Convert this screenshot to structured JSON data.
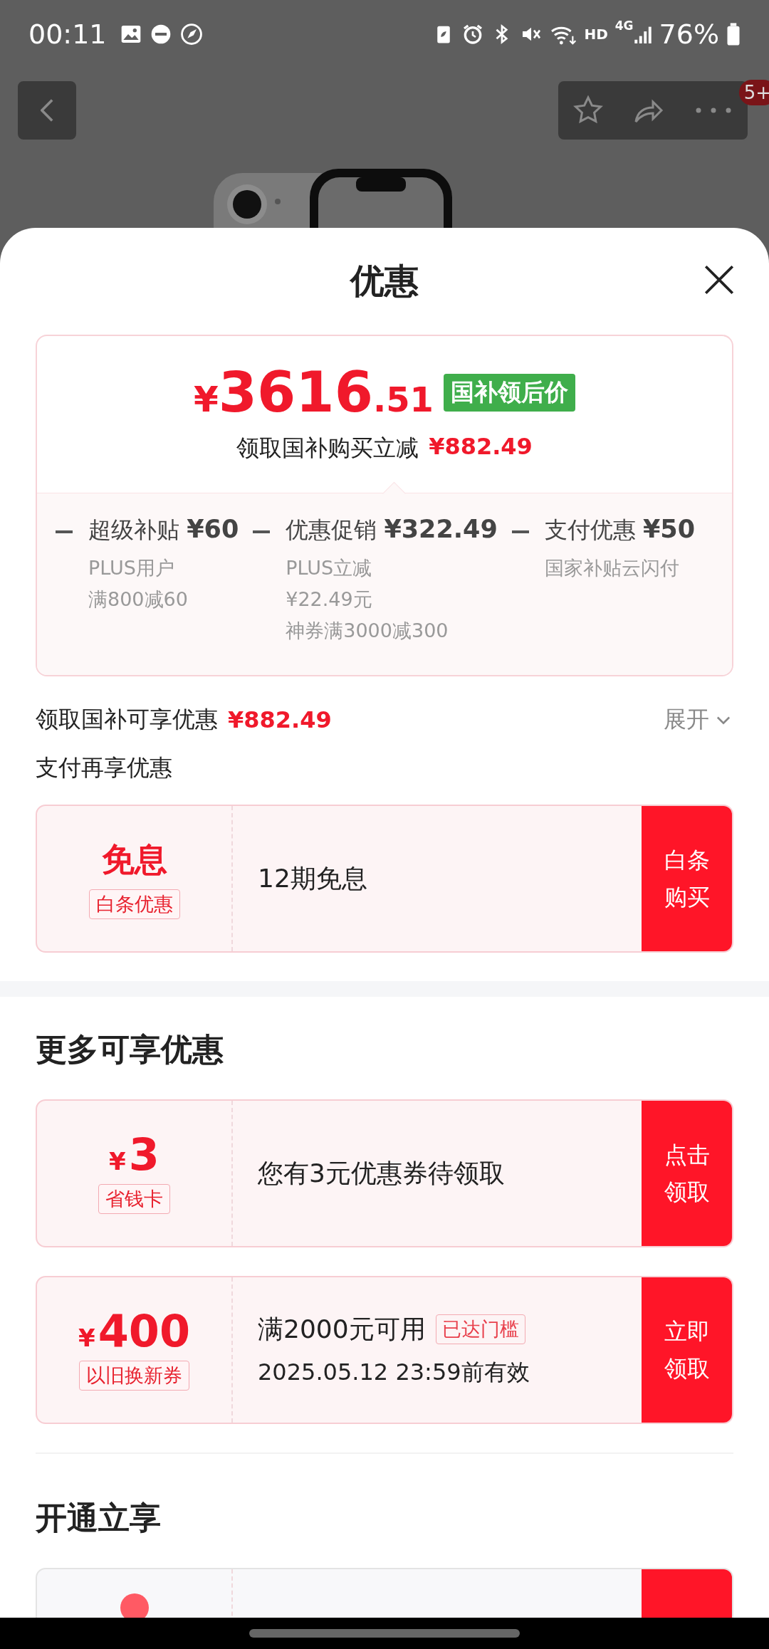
{
  "status_bar": {
    "time": "00:11",
    "battery": "76%",
    "network": "4G",
    "hd": "HD"
  },
  "top_bar": {
    "badge": "5+"
  },
  "sheet": {
    "title": "优惠",
    "price_card": {
      "currency": "¥",
      "integer": "3616",
      "decimal": ".51",
      "badge": "国补领后价",
      "saving_label": "领取国补购买立减",
      "saving_amount": "¥882.49",
      "discounts": [
        {
          "title": "超级补贴",
          "amount": "¥60",
          "notes": [
            "PLUS用户",
            "满800减60"
          ]
        },
        {
          "title": "优惠促销",
          "amount": "¥322.49",
          "notes": [
            "PLUS立减",
            "¥22.49元",
            "神券满3000减300"
          ]
        },
        {
          "title": "支付优惠",
          "amount": "¥50",
          "notes": [
            "国家补贴云闪付"
          ]
        }
      ]
    },
    "summary": {
      "label": "领取国补可享优惠",
      "amount": "¥882.49",
      "toggle": "展开"
    },
    "sections": [
      {
        "title": "支付再享优惠",
        "kind": "plain",
        "coupons": [
          {
            "kind": "text",
            "headline": "免息",
            "tag": "白条优惠",
            "lines": [
              "12期免息"
            ],
            "action": "白条购买"
          }
        ]
      },
      {
        "title": "更多可享优惠",
        "kind": "heading",
        "coupons": [
          {
            "kind": "money",
            "currency": "¥",
            "value": "3",
            "tag": "省钱卡",
            "lines": [
              "您有3元优惠券待领取"
            ],
            "action": "点击领取"
          },
          {
            "kind": "money",
            "currency": "¥",
            "value": "400",
            "tag": "以旧换新券",
            "lines": [
              "满2000元可用",
              "2025.05.12 23:59前有效"
            ],
            "line_tag": "已达门槛",
            "action": "立即领取"
          }
        ]
      },
      {
        "title": "开通立享",
        "kind": "heading",
        "coupons": [
          {
            "kind": "partial"
          }
        ]
      }
    ]
  }
}
